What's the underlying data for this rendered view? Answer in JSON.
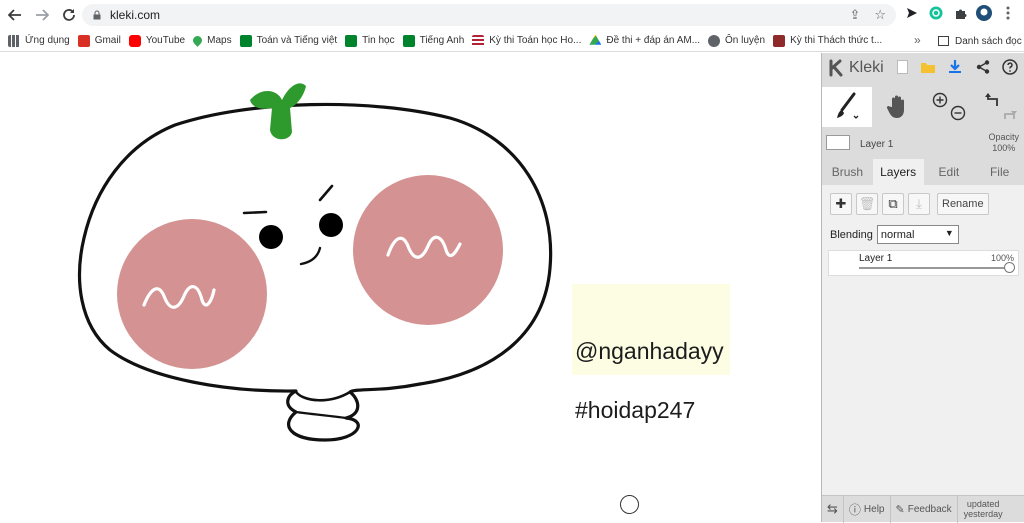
{
  "browser": {
    "url": "kleki.com",
    "bookmarks": [
      {
        "label": "Ứng dụng",
        "color": "#e34133"
      },
      {
        "label": "Gmail",
        "color": "#d93025"
      },
      {
        "label": "YouTube",
        "color": "#ff0000"
      },
      {
        "label": "Maps",
        "color": "#34a853"
      },
      {
        "label": "Toán và Tiếng việt",
        "color": "#00832d"
      },
      {
        "label": "Tin học",
        "color": "#00832d"
      },
      {
        "label": "Tiếng Anh",
        "color": "#00832d"
      },
      {
        "label": "Kỳ thi Toán học Ho...",
        "color": "#b22234"
      },
      {
        "label": "Đề thi + đáp án AM...",
        "color": "#1a73e8"
      },
      {
        "label": "Ôn luyện",
        "color": "#5f6368"
      },
      {
        "label": "Kỳ thi Thách thức t...",
        "color": "#8e2a2a"
      }
    ],
    "more_label": "»",
    "reading_list_label": "Danh sách đọc"
  },
  "canvas": {
    "handle_text": "@nganhadayy",
    "hashtag_text": "#hoidap247",
    "colors": {
      "cheek": "#d49292",
      "sprout": "#2e9a2e",
      "note_bg": "#fdfde4"
    }
  },
  "kleki": {
    "logo": "Kleki",
    "layer_name": "Layer 1",
    "opacity_label": "Opacity",
    "opacity_value": "100%",
    "tabs": [
      "Brush",
      "Layers",
      "Edit",
      "File"
    ],
    "active_tab": "Layers",
    "rename_label": "Rename",
    "blending_label": "Blending",
    "blending_value": "normal",
    "layer_item": {
      "name": "Layer 1",
      "opacity": "100%",
      "opacity_fraction": 1.0
    },
    "footer": {
      "help": "Help",
      "feedback": "Feedback",
      "updated_line1": "updated",
      "updated_line2": "yesterday"
    },
    "accent_color": "#1a73e8"
  }
}
